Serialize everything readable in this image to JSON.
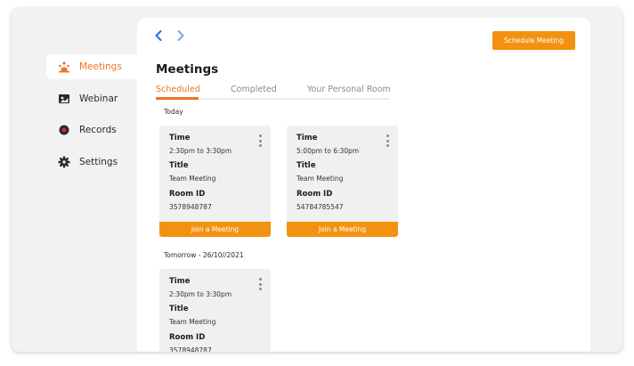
{
  "colors": {
    "accent": "#f39210",
    "active_text": "#ee7521"
  },
  "sidebar": {
    "items": [
      {
        "label": "Meetings",
        "icon": "meetings-icon",
        "active": true
      },
      {
        "label": "Webinar",
        "icon": "webinar-icon",
        "active": false
      },
      {
        "label": "Records",
        "icon": "record-icon",
        "active": false
      },
      {
        "label": "Settings",
        "icon": "gear-icon",
        "active": false
      }
    ]
  },
  "header": {
    "title": "Meetings",
    "schedule_label": "Schedule Meeting",
    "back_icon": "chevron-left-icon",
    "forward_icon": "chevron-right-icon"
  },
  "tabs": [
    {
      "label": "Scheduled",
      "active": true
    },
    {
      "label": "Completed",
      "active": false
    },
    {
      "label": "Your Personal Room",
      "active": false
    }
  ],
  "sections": [
    {
      "label": "Today",
      "cards": [
        {
          "time_label": "Time",
          "time": "2:30pm to 3:30pm",
          "title_label": "Title",
          "title": "Team Meeting",
          "room_label": "Room ID",
          "room": "3578948787",
          "join_label": "Join a Meeting"
        },
        {
          "time_label": "Time",
          "time": "5:00pm to 6:30pm",
          "title_label": "Title",
          "title": "Team Meeting",
          "room_label": "Room ID",
          "room": "54784785547",
          "join_label": "Join a Meeting"
        }
      ]
    },
    {
      "label": "Tomorrow - 26/10//2021",
      "cards": [
        {
          "time_label": "Time",
          "time": "2:30pm to 3:30pm",
          "title_label": "Title",
          "title": "Team Meeting",
          "room_label": "Room ID",
          "room": "3578948787"
        }
      ]
    }
  ]
}
